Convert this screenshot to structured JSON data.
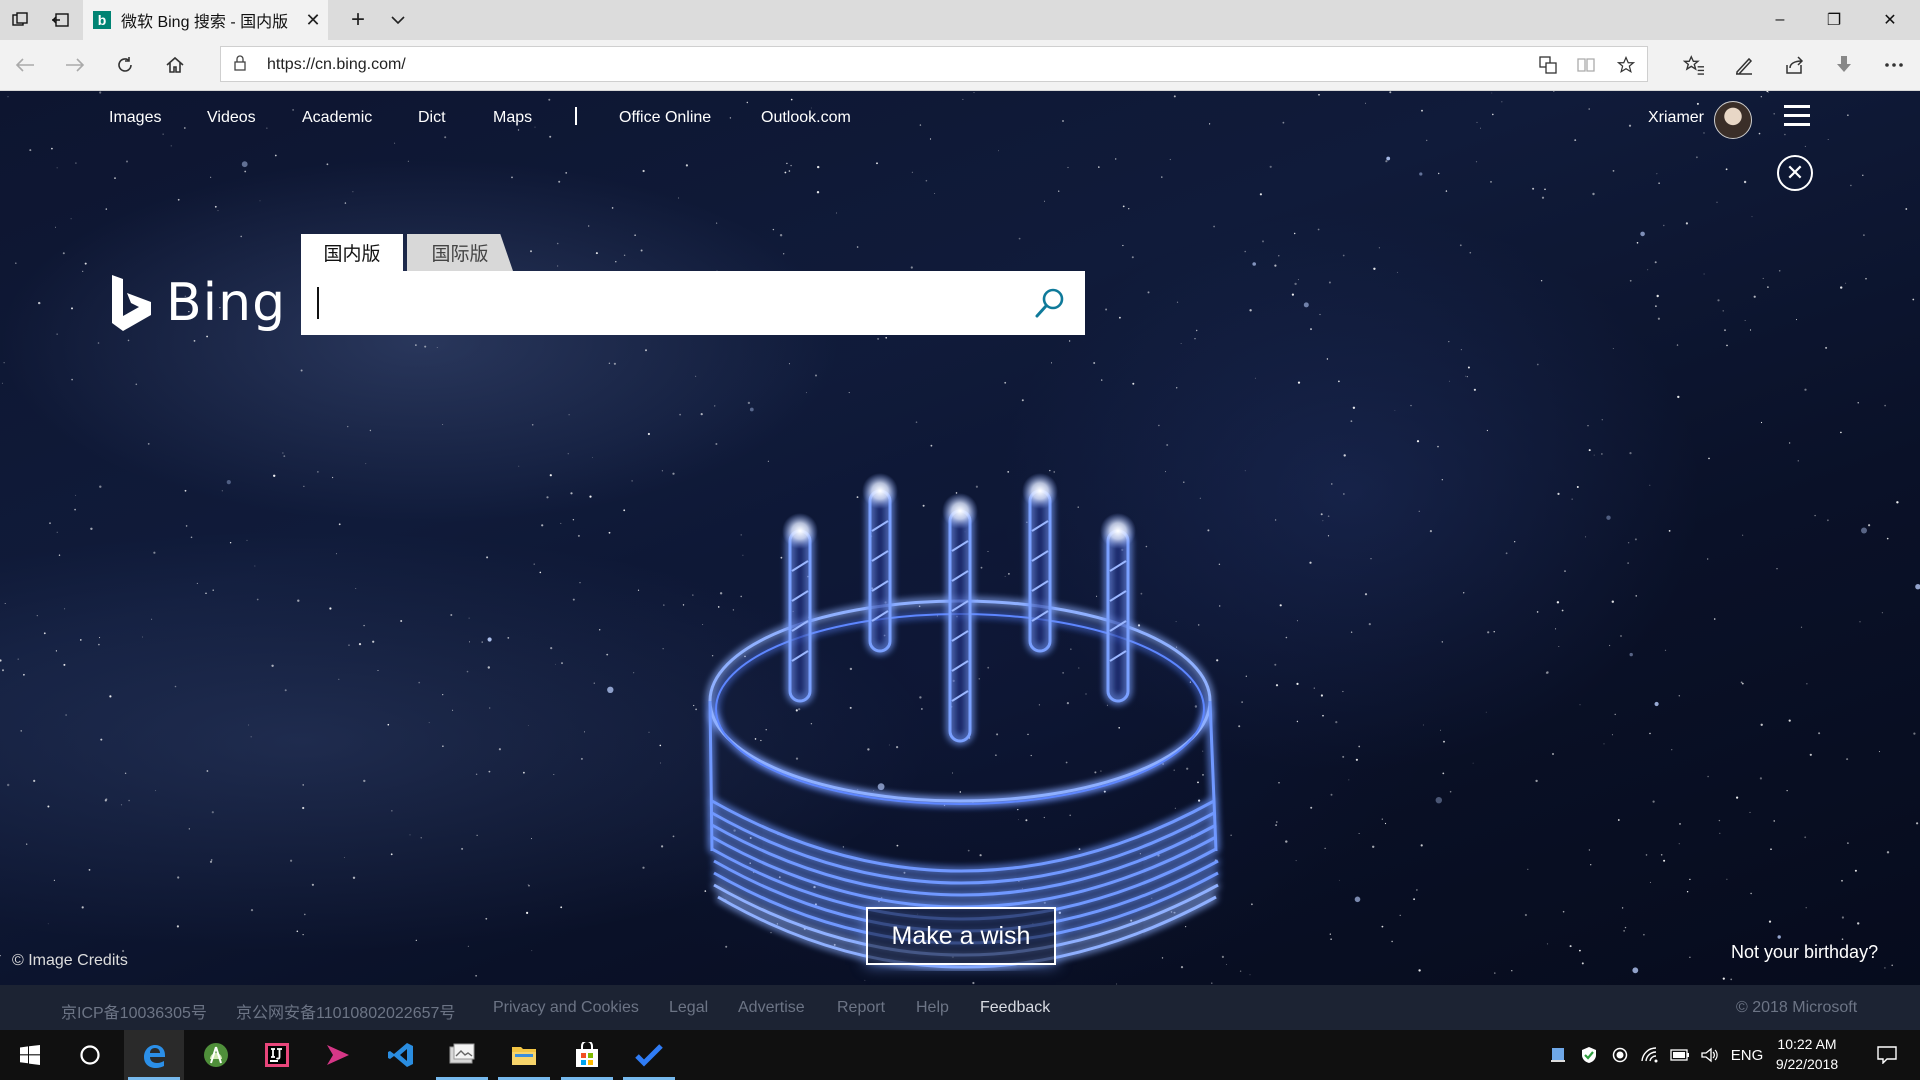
{
  "browser": {
    "tab": {
      "title": "微软 Bing 搜索 - 国内版",
      "favicon": "bing-favicon",
      "close": "✕"
    },
    "new_tab": "+",
    "window_controls": {
      "minimize": "–",
      "restore": "❐",
      "close": "✕"
    },
    "address": {
      "url": "https://cn.bing.com/"
    }
  },
  "page": {
    "top_links": [
      "Images",
      "Videos",
      "Academic",
      "Dict",
      "Maps",
      "Office Online",
      "Outlook.com"
    ],
    "user": {
      "name": "Xriamer"
    },
    "logo_text": "Bing",
    "scope_tabs": [
      "国内版",
      "国际版"
    ],
    "search": {
      "value": ""
    },
    "wish_button": "Make a wish",
    "image_credits": "© Image Credits",
    "not_birthday": "Not your birthday?",
    "accent_color": "#4f7dff"
  },
  "footer": {
    "links": [
      "京ICP备10036305号",
      "京公网安备11010802022657号",
      "Privacy and Cookies",
      "Legal",
      "Advertise",
      "Report",
      "Help",
      "Feedback"
    ],
    "copyright": "© 2018 Microsoft"
  },
  "taskbar": {
    "apps": [
      "start-icon",
      "cortana-icon",
      "edge-icon",
      "android-studio-icon",
      "intellij-icon",
      "media-icon",
      "vscode-icon",
      "photos-icon",
      "file-explorer-icon",
      "store-icon",
      "todo-icon"
    ],
    "language": "ENG",
    "time": "10:22 AM",
    "date": "9/22/2018"
  }
}
